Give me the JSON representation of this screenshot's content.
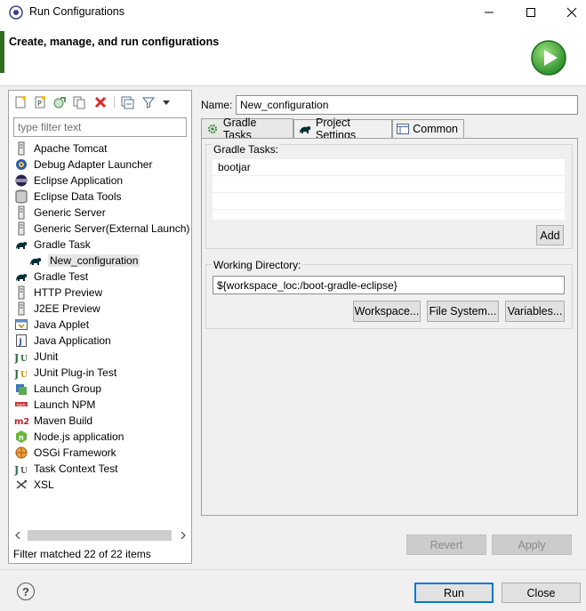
{
  "window": {
    "title": "Run Configurations"
  },
  "header": {
    "title": "Create, manage, and run configurations"
  },
  "toolbar": {
    "icons": [
      "new-configuration-icon",
      "new-prototype-icon",
      "export-icon",
      "duplicate-icon",
      "delete-icon",
      "collapse-all-icon",
      "filter-icon",
      "view-menu-icon"
    ]
  },
  "filter": {
    "placeholder": "type filter text",
    "value": ""
  },
  "tree": {
    "items": [
      {
        "label": "Apache Tomcat",
        "icon": "server-icon"
      },
      {
        "label": "Debug Adapter Launcher",
        "icon": "debug-adapter-icon"
      },
      {
        "label": "Eclipse Application",
        "icon": "eclipse-icon"
      },
      {
        "label": "Eclipse Data Tools",
        "icon": "database-icon"
      },
      {
        "label": "Generic Server",
        "icon": "server-icon"
      },
      {
        "label": "Generic Server(External Launch)",
        "icon": "server-icon"
      },
      {
        "label": "Gradle Task",
        "icon": "gradle-icon"
      },
      {
        "label": "New_configuration",
        "icon": "gradle-icon",
        "child": true,
        "selected": true
      },
      {
        "label": "Gradle Test",
        "icon": "gradle-icon"
      },
      {
        "label": "HTTP Preview",
        "icon": "server-icon"
      },
      {
        "label": "J2EE Preview",
        "icon": "server-icon"
      },
      {
        "label": "Java Applet",
        "icon": "java-applet-icon"
      },
      {
        "label": "Java Application",
        "icon": "java-application-icon"
      },
      {
        "label": "JUnit",
        "icon": "junit-icon"
      },
      {
        "label": "JUnit Plug-in Test",
        "icon": "junit-plugin-icon"
      },
      {
        "label": "Launch Group",
        "icon": "launch-group-icon"
      },
      {
        "label": "Launch NPM",
        "icon": "npm-icon"
      },
      {
        "label": "Maven Build",
        "icon": "maven-icon"
      },
      {
        "label": "Node.js application",
        "icon": "nodejs-icon"
      },
      {
        "label": "OSGi Framework",
        "icon": "osgi-icon"
      },
      {
        "label": "Task Context Test",
        "icon": "task-context-icon"
      },
      {
        "label": "XSL",
        "icon": "xsl-icon"
      }
    ],
    "status": "Filter matched 22 of 22 items"
  },
  "name": {
    "label": "Name:",
    "value": "New_configuration"
  },
  "tabs": [
    {
      "label": "Gradle Tasks",
      "icon": "gear-icon",
      "active": true
    },
    {
      "label": "Project Settings",
      "icon": "gradle-icon",
      "active": false
    },
    {
      "label": "Common",
      "icon": "common-tab-icon",
      "active": false
    }
  ],
  "gradle_tasks": {
    "group_label": "Gradle Tasks:",
    "tasks": [
      "bootjar",
      "",
      ""
    ],
    "add_label": "Add"
  },
  "working_dir": {
    "group_label": "Working Directory:",
    "value": "${workspace_loc:/boot-gradle-eclipse}",
    "workspace_label": "Workspace...",
    "filesystem_label": "File System...",
    "variables_label": "Variables..."
  },
  "actions": {
    "revert_label": "Revert",
    "apply_label": "Apply",
    "run_label": "Run",
    "close_label": "Close"
  },
  "help": {
    "glyph": "?"
  },
  "colors": {
    "gradle": "#02303a",
    "delete": "#d92b2b",
    "run_green": "#3aa43a",
    "selection": "#e5e5e5",
    "default_button_border": "#0078d7"
  }
}
